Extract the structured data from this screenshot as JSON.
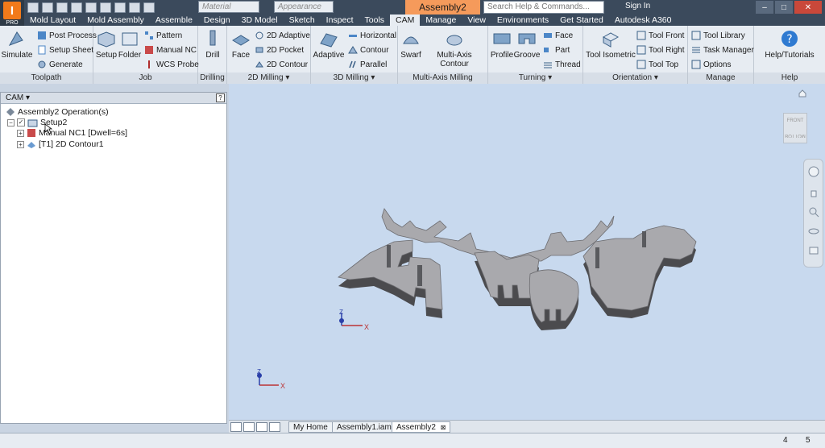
{
  "app": {
    "badge": "PRO"
  },
  "quick_access": {
    "material": "Material",
    "appearance": "Appearance"
  },
  "window": {
    "title": "Assembly2",
    "search_placeholder": "Search Help & Commands...",
    "sign_in": "Sign In"
  },
  "menu_tabs": [
    "Mold Layout",
    "Mold Assembly",
    "Assemble",
    "Design",
    "3D Model",
    "Sketch",
    "Inspect",
    "Tools",
    "CAM",
    "Manage",
    "View",
    "Environments",
    "Get Started",
    "Autodesk A360"
  ],
  "active_menu_tab": "CAM",
  "ribbon": {
    "toolpath": {
      "label": "Toolpath",
      "simulate": "Simulate",
      "post_process": "Post Process",
      "setup_sheet": "Setup Sheet",
      "generate": "Generate"
    },
    "job": {
      "label": "Job",
      "setup": "Setup",
      "folder": "Folder",
      "pattern": "Pattern",
      "manual_nc": "Manual NC",
      "wcs_probe": "WCS Probe"
    },
    "drilling": {
      "label": "Drilling",
      "drill": "Drill"
    },
    "milling2d": {
      "label": "2D Milling",
      "face": "Face",
      "adaptive_2d": "2D Adaptive",
      "pocket_2d": "2D Pocket",
      "contour_2d": "2D Contour"
    },
    "milling3d": {
      "label": "3D Milling",
      "adaptive": "Adaptive",
      "horizontal": "Horizontal",
      "contour": "Contour",
      "parallel": "Parallel"
    },
    "multiaxis": {
      "label": "Multi-Axis Milling",
      "swarf": "Swarf",
      "multi_axis_contour": "Multi-Axis Contour"
    },
    "turning": {
      "label": "Turning",
      "profile": "Profile",
      "groove": "Groove",
      "face": "Face",
      "part": "Part",
      "thread": "Thread"
    },
    "orientation": {
      "label": "Orientation",
      "tool_isometric": "Tool Isometric",
      "tool_front": "Tool Front",
      "tool_right": "Tool Right",
      "tool_top": "Tool Top"
    },
    "manage": {
      "label": "Manage",
      "tool_library": "Tool Library",
      "task_manager": "Task Manager",
      "options": "Options"
    },
    "help": {
      "label": "Help",
      "help_tutorials": "Help/Tutorials"
    }
  },
  "browser": {
    "title": "CAM",
    "root": "Assembly2 Operation(s)",
    "setup": "Setup2",
    "items": [
      "Manual NC1 [Dwell=6s]",
      "[T1] 2D Contour1"
    ]
  },
  "viewport": {
    "viewcube_front": "FRONT",
    "viewcube_bottom": "BOTTOM",
    "axis_z": "Z",
    "axis_x": "X"
  },
  "doc_tabs": [
    "My Home",
    "Assembly1.iam",
    "Assembly2"
  ],
  "status": {
    "count_a": "4",
    "count_b": "5"
  },
  "colors": {
    "accent": "#f59a5b",
    "chrome": "#3b4a5c",
    "part_face": "#a9a9ad"
  }
}
